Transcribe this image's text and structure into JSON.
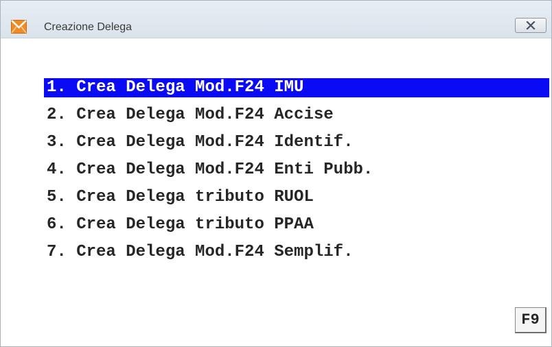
{
  "window": {
    "title": "Creazione Delega",
    "app_icon": "envelope-icon",
    "close_icon": "close-icon"
  },
  "menu": {
    "items": [
      {
        "label": "1. Crea Delega Mod.F24 IMU",
        "selected": true
      },
      {
        "label": "2. Crea Delega Mod.F24 Accise",
        "selected": false
      },
      {
        "label": "3. Crea Delega Mod.F24 Identif.",
        "selected": false
      },
      {
        "label": "4. Crea Delega Mod.F24 Enti Pubb.",
        "selected": false
      },
      {
        "label": "5. Crea Delega tributo RUOL",
        "selected": false
      },
      {
        "label": "6. Crea Delega tributo PPAA",
        "selected": false
      },
      {
        "label": "7. Crea Delega Mod.F24 Semplif.",
        "selected": false
      }
    ]
  },
  "function_key": {
    "label": "F9"
  },
  "colors": {
    "selection": "#0a0af5",
    "selection_text": "#ffffff",
    "menu_text": "#262626",
    "titlebar": "#dbe3ec"
  }
}
